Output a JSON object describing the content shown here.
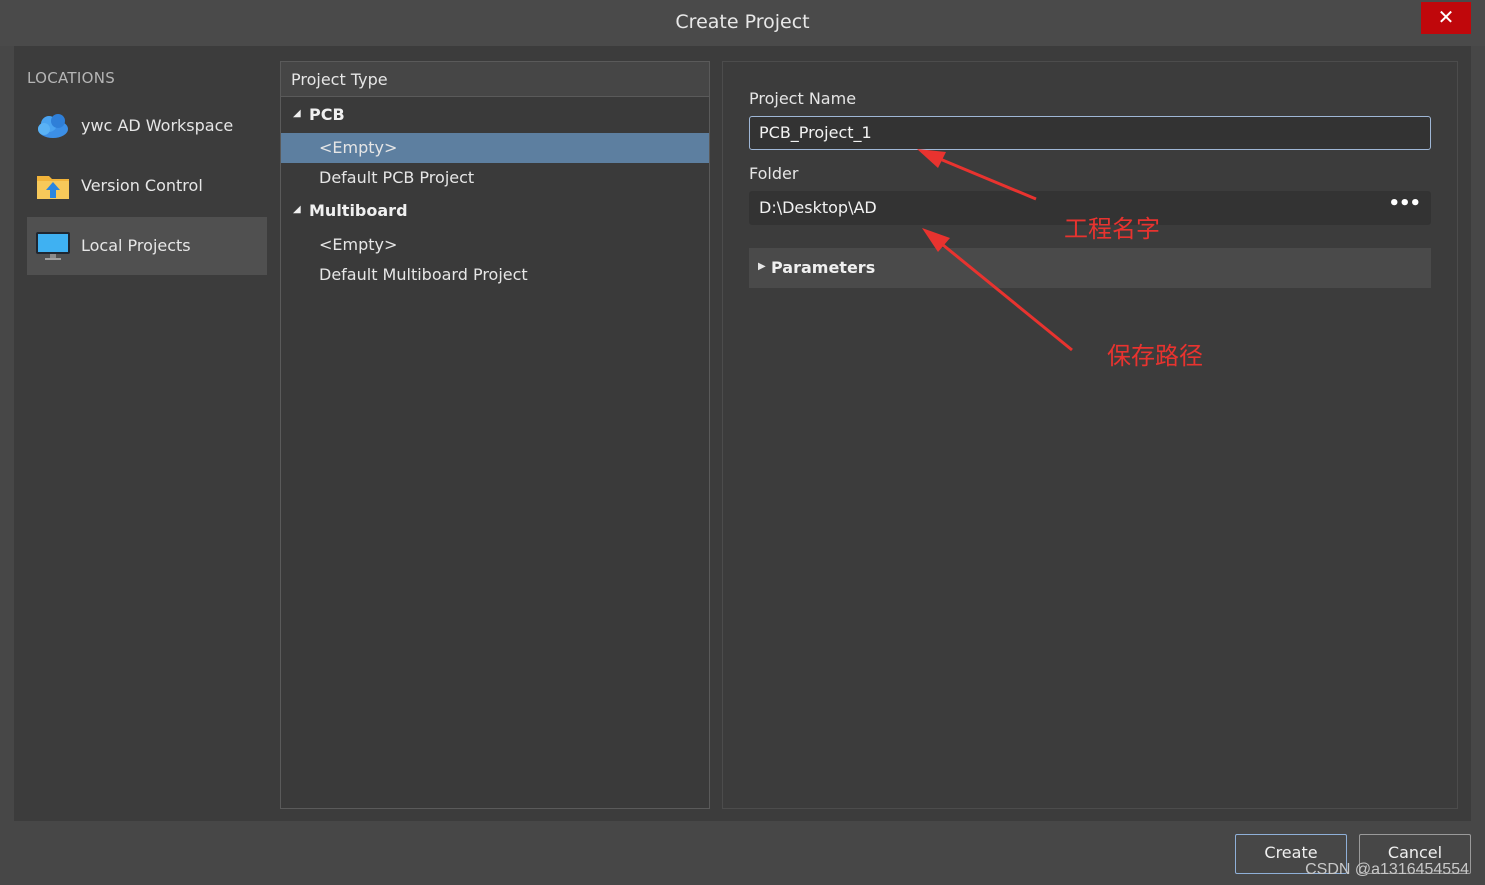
{
  "window": {
    "title": "Create Project",
    "close_label": "✕"
  },
  "locations": {
    "header": "LOCATIONS",
    "items": [
      {
        "label": "ywc AD Workspace",
        "icon": "cloud-icon"
      },
      {
        "label": "Version Control",
        "icon": "folder-upload-icon"
      },
      {
        "label": "Local Projects",
        "icon": "monitor-icon",
        "active": true
      }
    ]
  },
  "project_type": {
    "header": "Project Type",
    "groups": [
      {
        "label": "PCB",
        "items": [
          "<Empty>",
          "Default PCB Project"
        ]
      },
      {
        "label": "Multiboard",
        "items": [
          "<Empty>",
          "Default Multiboard Project"
        ]
      }
    ],
    "selected": "PCB / <Empty>"
  },
  "form": {
    "project_name_label": "Project Name",
    "project_name_value": "PCB_Project_1",
    "folder_label": "Folder",
    "folder_value": "D:\\Desktop\\AD",
    "folder_browse": "•••",
    "parameters_label": "Parameters"
  },
  "annotations": {
    "name_note": "工程名字",
    "path_note": "保存路径",
    "color": "#e8332f"
  },
  "buttons": {
    "create": "Create",
    "cancel": "Cancel"
  },
  "watermark": "CSDN @a1316454554",
  "colors": {
    "selection": "#5d7fa0",
    "close": "#c0070b"
  }
}
